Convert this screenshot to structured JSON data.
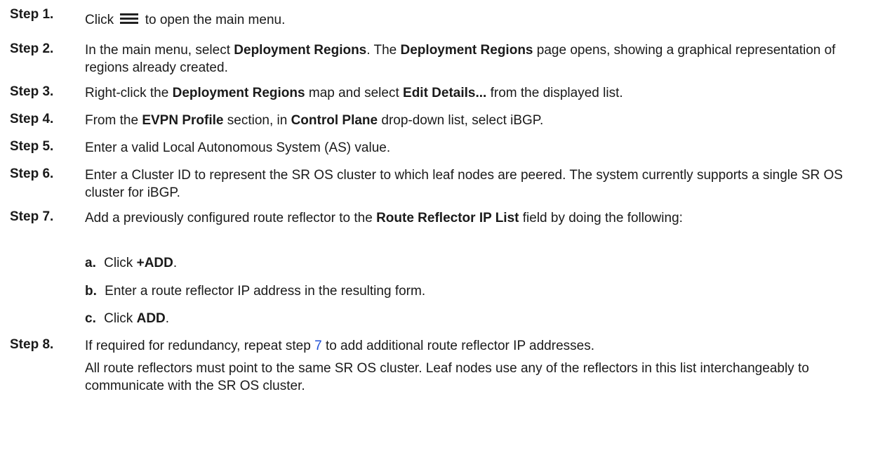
{
  "steps": {
    "s1": {
      "num": "Step 1.",
      "a": "Click",
      "b": "to open the main menu."
    },
    "s2": {
      "num": "Step 2.",
      "a": "In the main menu, select",
      "b1": "Deployment Regions",
      "c": ". The",
      "b2": "Deployment Regions",
      "d": "page opens, showing a graphical representation of regions already created."
    },
    "s3": {
      "num": "Step 3.",
      "a": "Right-click the",
      "b1": "Deployment Regions",
      "c": "map and select",
      "b2": "Edit Details...",
      "d": "from the displayed list."
    },
    "s4": {
      "num": "Step 4.",
      "a": "From the",
      "b1": "EVPN Profile",
      "c": "section, in",
      "b2": "Control Plane",
      "d": "drop-down list, select iBGP."
    },
    "s5": {
      "num": "Step 5.",
      "text": "Enter a valid Local Autonomous System (AS) value."
    },
    "s6": {
      "num": "Step 6.",
      "text": "Enter a Cluster ID to represent the SR OS cluster to which leaf nodes are peered. The system currently supports a single SR OS cluster for iBGP."
    },
    "s7": {
      "num": "Step 7.",
      "a": "Add a previously configured route reflector to the",
      "b1": "Route Reflector IP List",
      "c": "field by doing the following:",
      "subs": [
        {
          "letter": "a.",
          "a": "Click",
          "b": "+ADD",
          "c": "."
        },
        {
          "letter": "b.",
          "text": "Enter a route reflector IP address in the resulting form."
        },
        {
          "letter": "c.",
          "a": "Click",
          "b": "ADD",
          "c": "."
        }
      ]
    },
    "s8": {
      "num": "Step 8.",
      "a": "If required for redundancy, repeat step",
      "link": "7",
      "b": "to add additional route reflector IP addresses.",
      "note": "All route reflectors must point to the same SR OS cluster. Leaf nodes use any of the reflectors in this list interchangeably to communicate with the SR OS cluster."
    }
  },
  "icons": {
    "menu": "hamburger-menu-icon"
  },
  "colors": {
    "link": "#1f4fd6",
    "text": "#1a1a1a"
  }
}
